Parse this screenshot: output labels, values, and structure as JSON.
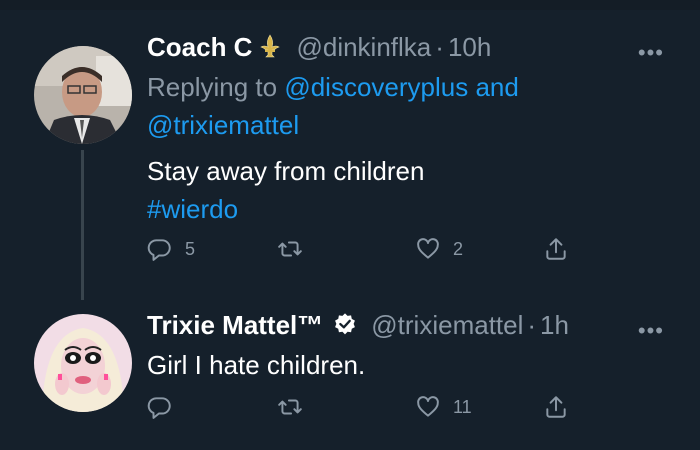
{
  "tweets": [
    {
      "display_name": "Coach C",
      "badge": "fleur-de-lis-icon",
      "handle": "@dinkinflka",
      "dot": "·",
      "time": "10h",
      "replying_to_prefix": "Replying to",
      "reply_mention_1": "@discoveryplus",
      "reply_and": "and",
      "reply_mention_2": "@trixiemattel",
      "text": "Stay away from children",
      "hashtag": "#wierdo",
      "reply_count": "5",
      "retweet_count": "",
      "like_count": "2"
    },
    {
      "display_name": "Trixie Mattel™",
      "badge": "verified-icon",
      "handle": "@trixiemattel",
      "dot": "·",
      "time": "1h",
      "text": "Girl I hate children.",
      "reply_count": "",
      "retweet_count": "",
      "like_count": "11"
    }
  ],
  "colors": {
    "background": "#15202b",
    "text": "#ffffff",
    "secondary": "#8b98a5",
    "link": "#1d9bf0",
    "thread_line": "#38444d"
  }
}
